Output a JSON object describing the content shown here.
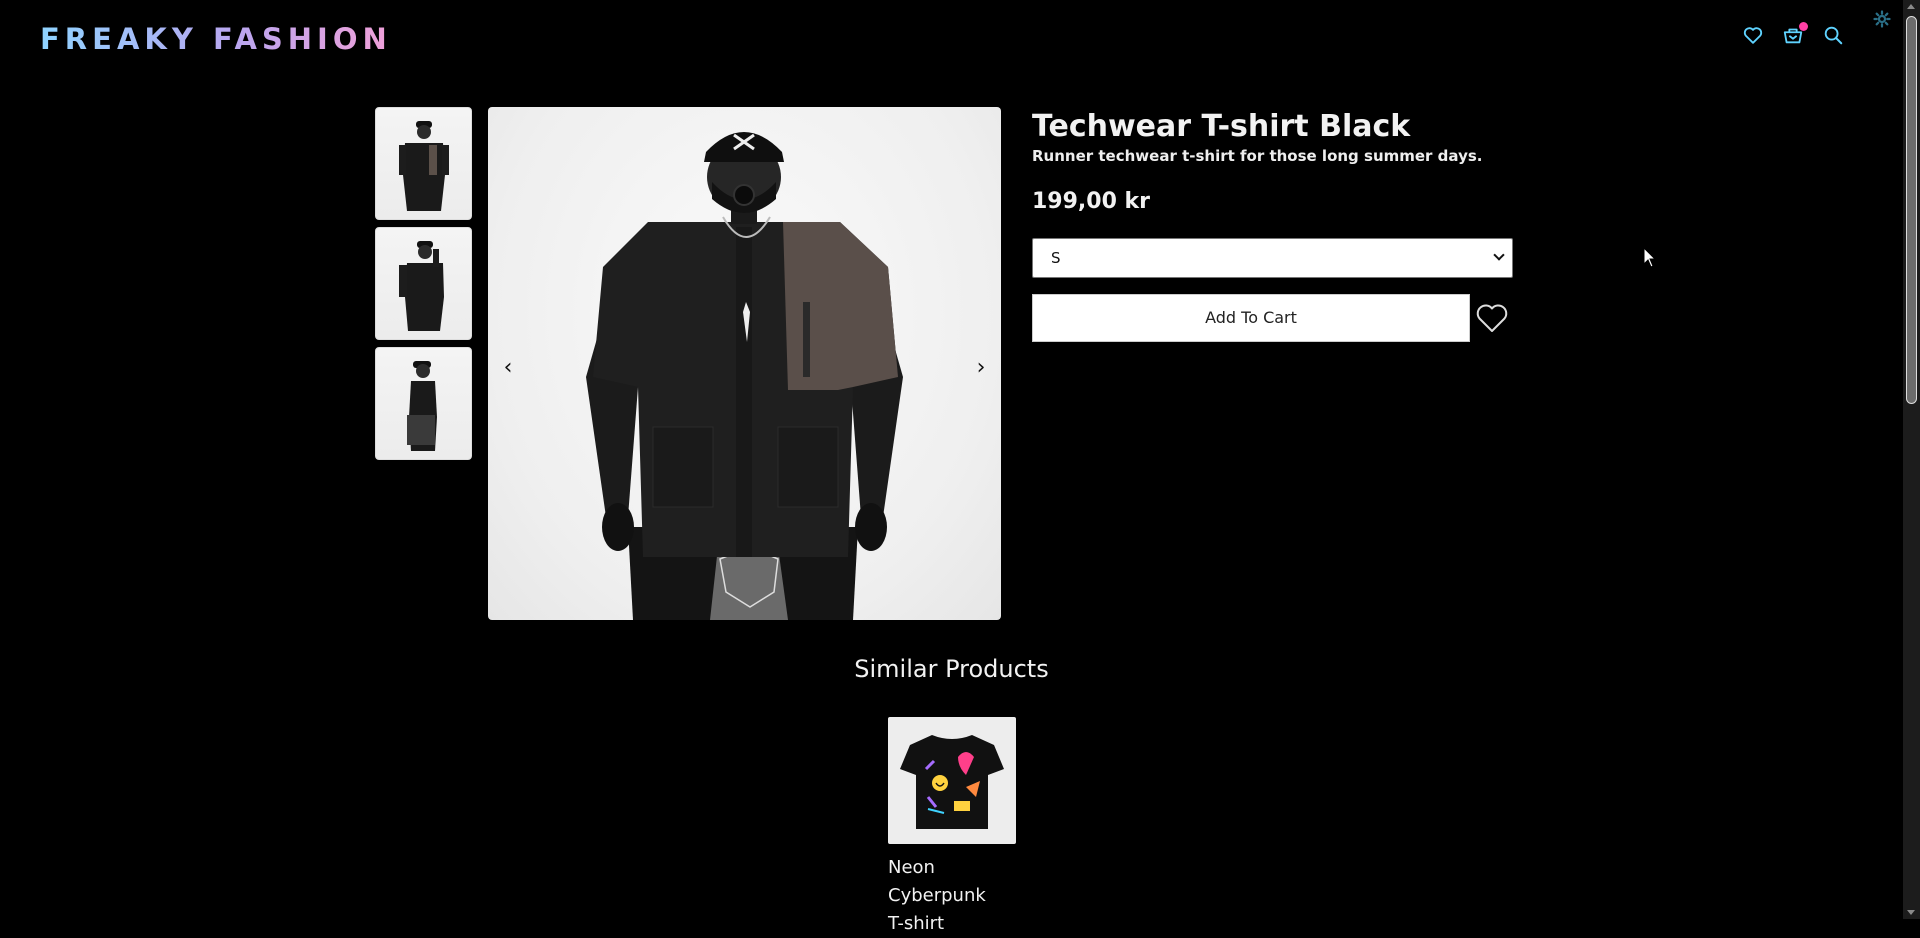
{
  "brand": {
    "logo_text": "FREAKY FASHION"
  },
  "header": {
    "icons": [
      "heart-icon",
      "cart-icon",
      "search-icon"
    ],
    "cart_has_items": true,
    "accent_color": "#5fd3ff",
    "badge_color": "#ff3fa4"
  },
  "gallery": {
    "thumbnails": [
      "front view",
      "side view",
      "profile view"
    ],
    "prev_label": "‹",
    "next_label": "›"
  },
  "product": {
    "title": "Techwear T-shirt Black",
    "subtitle": "Runner techwear t-shirt for those long summer days.",
    "price": "199,00 kr",
    "selected_size": "S",
    "add_to_cart_label": "Add To Cart"
  },
  "similar": {
    "heading": "Similar Products",
    "items": [
      {
        "name": "Neon Cyberpunk T-shirt"
      }
    ]
  }
}
